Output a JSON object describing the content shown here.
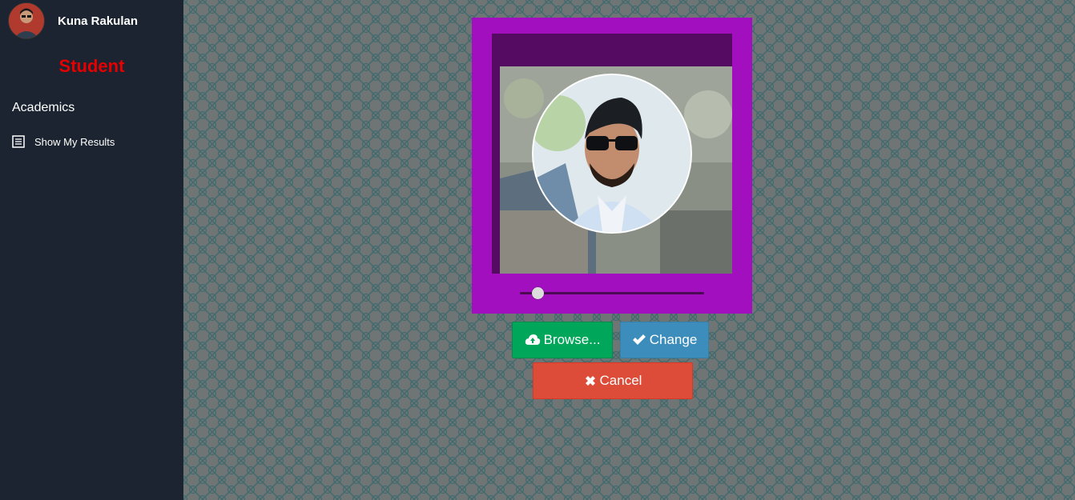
{
  "sidebar": {
    "user_name": "Kuna Rakulan",
    "role": "Student",
    "section_title": "Academics",
    "items": [
      {
        "label": "Show My Results",
        "icon": "list-icon"
      }
    ]
  },
  "editor": {
    "zoom_level": 0.07
  },
  "buttons": {
    "browse_label": "Browse...",
    "change_label": "Change",
    "cancel_label": "Cancel"
  },
  "colors": {
    "sidebar_bg": "#1b2430",
    "role": "#e60000",
    "editor_frame": "#a10fbe",
    "browse": "#00a65a",
    "change": "#3c8dbc",
    "cancel": "#dd4b39"
  }
}
